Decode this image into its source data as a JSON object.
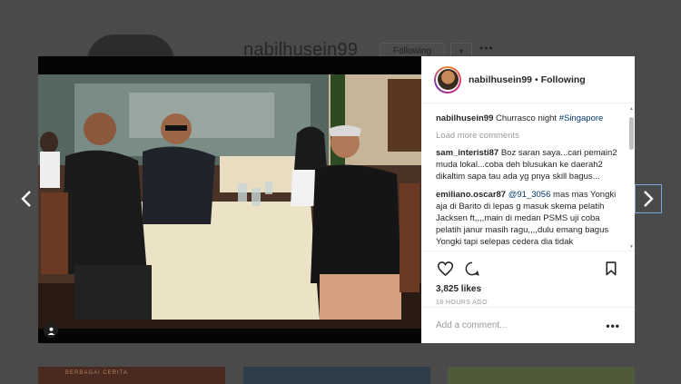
{
  "background_profile": {
    "username": "nabilhusein99",
    "following_label": "Following",
    "caret": "▾",
    "more": "•••",
    "thumb_text": "BERBAGAI CERITA"
  },
  "navigation": {
    "prev_icon": "chevron-left-icon",
    "next_icon": "chevron-right-icon"
  },
  "post": {
    "header": {
      "username": "nabilhusein99",
      "separator": "•",
      "follow_status": "Following"
    },
    "caption": {
      "user": "nabilhusein99",
      "text": "Churrasco night ",
      "hashtag": "#Singapore"
    },
    "load_more": "Load more comments",
    "comments": [
      {
        "user": "sam_interisti87",
        "text": " Boz saran saya...cari pemain2 muda lokal...coba deh blusukan ke daerah2 dikaltim sapa tau ada yg pnya skill bagus..."
      },
      {
        "user": "emiliano.oscar87",
        "mention": "@91_3056",
        "text": " mas mas Yongki aja di Barito di lepas g masuk skema pelatih Jacksen ft,,,,main di medan PSMS uji coba pelatih janur masih ragu,,,,dulu emang bagus Yongki tapi selepas cedera dia tidak"
      }
    ],
    "likes": "3,825 likes",
    "time": "18 HOURS AGO",
    "add_comment_placeholder": "Add a comment...",
    "more_options": "•••",
    "accent_link": "#003569"
  }
}
